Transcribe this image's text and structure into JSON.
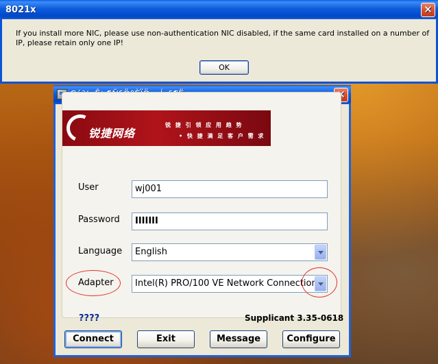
{
  "msgbox": {
    "title": "8021x",
    "close_glyph": "✕",
    "message": "If you install more NIC, please use non-authentication NIC disabled, if the same card installed on a number of IP, please retain only one IP!",
    "ok_label": "OK"
  },
  "dialog": {
    "title": "Çú¾¸Ê¦·¶Ñ§Ö°ÈÏÖ¤¿Í»§¶Ë",
    "close_glyph": "✕",
    "banner": {
      "logo_text": "锐捷网络",
      "line1": "锐 捷 引 领 应 用 趋 势",
      "line2": "• 快 捷 满 足 客 户 需 求"
    },
    "user_label": "User",
    "user_value": "wj001",
    "password_label": "Password",
    "password_value": "IIIIIII",
    "language_label": "Language",
    "language_value": "English",
    "adapter_label": "Adapter",
    "adapter_value": "Intel(R) PRO/100 VE Network Connection",
    "help_text": "????",
    "version_text": "Supplicant 3.35-0618",
    "buttons": {
      "connect": "Connect",
      "exit": "Exit",
      "message": "Message",
      "configure": "Configure"
    }
  },
  "colors": {
    "titlebar": "#0047c8",
    "annotation": "#e0302a",
    "banner": "#b0141a"
  }
}
